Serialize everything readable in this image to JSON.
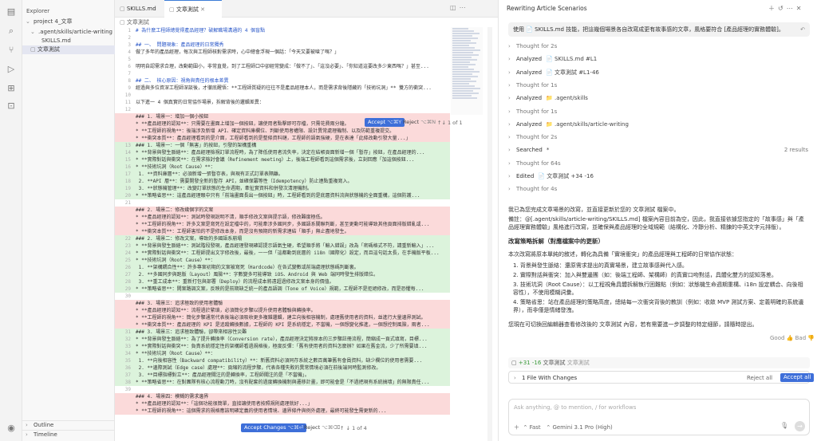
{
  "activity": {
    "icons": [
      "files-icon",
      "search-icon",
      "source-control-icon",
      "run-icon",
      "extensions-icon",
      "remote-icon",
      "account-icon"
    ]
  },
  "explorer": {
    "title": "Explorer",
    "project": "project 4_文章",
    "folder": ".agent/skills/article-writing",
    "file1": "SKILLS.md",
    "file2": "文章測試",
    "outline": "Outline",
    "timeline": "Timeline"
  },
  "tabs": {
    "tab1": "SKILLS.md",
    "tab2": "文章測試",
    "breadcrumb": "文章測試"
  },
  "code": {
    "lines": [
      {
        "n": "1",
        "t": "#  為什麼工程師總覺得產品經理？破解職場溝通的 4 個盲點",
        "k": "hd"
      },
      {
        "n": "2",
        "t": "",
        "k": ""
      },
      {
        "n": "3",
        "t": "## 一、 問題現象：產品經理的日常獨秀",
        "k": "hd"
      },
      {
        "n": "4",
        "t": "做了多年的產品經理，每次與工程師核對需求時，心中總會浮現一個話：「今天又要被嗆了嗎？」",
        "k": ""
      },
      {
        "n": "5",
        "t": "",
        "k": ""
      },
      {
        "n": "6",
        "t": "明明自認需求合理，改動範圍小，非常直覺，到了工程師口中卻經常變成：「做不了」、「這沒必要」、「你知道這要改多少東西嗎？」甚至...",
        "k": ""
      },
      {
        "n": "7",
        "t": "",
        "k": ""
      },
      {
        "n": "8",
        "t": "## 二、 核心原因：視角與責任的根本差異",
        "k": "hd"
      },
      {
        "n": "9",
        "t": "經過與多位資深工程師深談後，才徹底醒悟：**工程師質疑的往往不是產品經理本人，而是需求背後隱藏的「技術坑洞」** 雙方的衝突...",
        "k": ""
      },
      {
        "n": "10",
        "t": "",
        "k": ""
      },
      {
        "n": "11",
        "t": "以下進一 4 個真實的日常協作場景，拆解背後的邏輯差異：",
        "k": ""
      },
      {
        "n": "12",
        "t": "",
        "k": ""
      },
      {
        "n": "",
        "t": "### 1. 場景一：增加一個小按鈕",
        "k": "del"
      },
      {
        "n": "",
        "t": "* **產品經理的認知**：只需要在畫面上增加一個按鈕，讓使用者點擊即可存檔，只需花費兩分鐘。",
        "k": "del"
      },
      {
        "n": "",
        "t": "* **工程師的視角**：後端涉及新增 API、確定資料庫欄位、判斷使用者權限、設計異常處理機制、以及防範重複提交。",
        "k": "del"
      },
      {
        "n": "",
        "t": "* **衝突本質**：產品經理看到的是介面，工程師看到的是整條資料鏈，工程師的語氣強硬，是在表達「此條改動引發大量...」",
        "k": "del"
      },
      {
        "n": "13",
        "t": "### 1. 場景一：一個「無害」的按鈕，引發的架構重構",
        "k": "add"
      },
      {
        "n": "14",
        "t": "*   **背景與發生脈絡**：產品經理檢視訂單流程時，為了降低使用者流失率，決定在結帳頁面新增一個「暫存」按鈕，在產品經理的...",
        "k": "add"
      },
      {
        "n": "15",
        "t": "*   **實際對話與衝突**：在需求檢討會議（Refinement meeting）上，後端工程師看到這個需求後，立刻回應「加這個按鈕...",
        "k": "add"
      },
      {
        "n": "16",
        "t": "*   **技術坑洞（Root Cause）**：",
        "k": "add"
      },
      {
        "n": "17",
        "t": "    1.  **資料庫層**：必須新增一張暫存表，與現有正式訂單表隔離。",
        "k": "add"
      },
      {
        "n": "18",
        "t": "    2.  **API 層**：需要開發全新的暫存 API，並確保冪等性（Idempotency）防止連點重複寫入。",
        "k": "add"
      },
      {
        "n": "19",
        "t": "    3.  **狀態機管理**：改變訂單狀態的生命週期，牽扯實資料和併發次清理機制。",
        "k": "add"
      },
      {
        "n": "20",
        "t": "*   **策略省思**：這產品經理眼中只有「前端畫面長出一個按鈕」時，工程師看到的是底層資料流與狀態機的全面重構，這個防護...",
        "k": "add"
      },
      {
        "n": "21",
        "t": "",
        "k": ""
      },
      {
        "n": "",
        "t": "### 2. 場景二：修改幾個字的文案",
        "k": "del"
      },
      {
        "n": "",
        "t": "* **產品經理的認知**：測試時發現說明不清，順手修改文案與提示語，修改難度極低。",
        "k": "del"
      },
      {
        "n": "",
        "t": "* **工程師的視角**：許多文案是寫死在設定檔中的，可能牽涉多國同步，多國語系關聯判斷，甚至更動可能導致其他頁面排版錯亂或...",
        "k": "del"
      },
      {
        "n": "",
        "t": "* **衝突本質**：工程師害怕的不是修改本身，而是沒有預期的新需求連結「順手」無止盡地發生。",
        "k": "del"
      },
      {
        "n": "22",
        "t": "### 2. 場景二：修改文案，導致的多國語系崩塌",
        "k": "add"
      },
      {
        "n": "23",
        "t": "*   **背景與發生脈絡**：測試階段發現，產品經理發現確認提示語氣生硬，希望順手將「輸入錯誤」改為「密碼格式不符，請重新輸入」...",
        "k": "add"
      },
      {
        "n": "24",
        "t": "*   **實際對話與衝突**：工程師提出文字修改後，最後，一一但「這都動到底層的 i18n（國際化）設定，而且這句話太長，在手機版平板...",
        "k": "add"
      },
      {
        "n": "25",
        "t": "*   **技術坑洞（Root Cause）**：",
        "k": "add"
      },
      {
        "n": "26",
        "t": "    1.  **架構耦合性**：許多專案初期的文案被寫死（Hardcode）在各式變數或前端處理狀態碼判斷裏。",
        "k": "add"
      },
      {
        "n": "27",
        "t": "    2.  **多國同步與跑版（Layout）風險**：字數變多可能導致 iOS、Android 與 Web 端同時發生排版錯位。",
        "k": "add"
      },
      {
        "n": "28",
        "t": "    3.  **重工成本**：重新打包與部署（Deploy）的流程成本將遠超過修改文案本身的價值。",
        "k": "add"
      },
      {
        "n": "29",
        "t": "*   **策略省思**：開案路調文案，反映的是前期缺乏統一的產品語調（Tone of Voice）規範，工程師不是拒絕修改，而是恐懼每...",
        "k": "add"
      },
      {
        "n": "30",
        "t": "",
        "k": ""
      },
      {
        "n": "",
        "t": "### 3. 場景三：追求極致的使用者體驗",
        "k": "del"
      },
      {
        "n": "",
        "t": "* **產品經理的認知**：流程過於繁瑣，必須簡化步驟以提升使用者體驗與轉換率。",
        "k": "del"
      },
      {
        "n": "",
        "t": "* **工程師的視角**：簡化步驟通常代表後端必須吸收更多複雜邏輯，建立向後相容機制，處理舊使用者的資料，並進行大量邊界測試。",
        "k": "del"
      },
      {
        "n": "",
        "t": "* **衝突本質**：產品經理的 KPI 是追蹤轉換數據，工程師的 KPI 是系統穩定，不當機，一個想變化推進，一個想控制風險，兩者...",
        "k": "del"
      },
      {
        "n": "31",
        "t": "### 3. 場景三：追求極致體驗，卻帶來相容性災難",
        "k": "add"
      },
      {
        "n": "32",
        "t": "*   **背景與發生脈絡**：為了提升轉換率（Conversion rate），產品經理決定將原本的三步驟註冊流程，簡縮成一頁式填寫，目標...",
        "k": "add"
      },
      {
        "n": "33",
        "t": "*   **實際對話與衝突**：負責系統穩定性的架構師看過規格後，極度反彈：「舊有使用者的資料怎麼辦？如果在舊金流，少了所需要填...",
        "k": "add"
      },
      {
        "n": "34",
        "t": "*   **技術坑洞（Root Cause）**：",
        "k": "add"
      },
      {
        "n": "35",
        "t": "    1.  **向後相容性（Backward compatibility）**：新舊資料必須同存系統之數百萬筆舊有會員資料，缺少欄位的使用者需要...",
        "k": "add"
      },
      {
        "n": "36",
        "t": "    2.  **邊際測試（Edge case）處理**：頁縮的流程步驟，代表各種失敗的異常情境必須在前後端同時監測修改。",
        "k": "add"
      },
      {
        "n": "37",
        "t": "    3.  **目標指標對立**：產品經理關注的是轉換率，工程師關注的是「不當機」。",
        "k": "add"
      },
      {
        "n": "38",
        "t": "*   **策略省思**：在對團隊有核心流程動刀時，沒有配套的過度轉換機制與遷移計畫，即可能會是「不過把現有系統搞壞」的無限責任...",
        "k": "add"
      },
      {
        "n": "39",
        "t": "",
        "k": ""
      },
      {
        "n": "",
        "t": "### 4. 場景四：模糊的需求邊界",
        "k": "del"
      },
      {
        "n": "",
        "t": "* **產品經理的認知**：「這個功能很簡單，直接讓使用者按照規則處理就好...」",
        "k": "del"
      },
      {
        "n": "",
        "t": "* **工程師的視角**：這個需求的規格應該明確定義的使用者情境、邊界條件與例外處理，最終可能發生需更新的...",
        "k": "del"
      }
    ]
  },
  "diffbar": {
    "accept": "Accept",
    "accept_kbd": "⌥⌘Y",
    "reject": "Reject",
    "reject_kbd": "⌥⌘N",
    "accept2": "Accept Changes",
    "accept2_kbd": "⌥⌘⏎",
    "reject2": "Reject",
    "reject2_kbd": "⌥⌘⌫",
    "nav": "1 of 1",
    "nav2": "1 of 4"
  },
  "chat": {
    "title": "Rewriting Article Scenarios",
    "user_msg": "使用 📄 SKILLS.md 技能，把這幾個場景各自改寫成更有故事感的文章，風格要符合 [產品經理的實務體驗]。",
    "steps": [
      {
        "t": "Thought for 2s",
        "c": ""
      },
      {
        "t": "Analyzed",
        "c": "📄 SKILLS.md #L1"
      },
      {
        "t": "Analyzed",
        "c": "📄 文章測試 #L1-46"
      },
      {
        "t": "Thought for 1s",
        "c": ""
      },
      {
        "t": "Analyzed",
        "c": "📁 .agent/skills"
      },
      {
        "t": "Thought for 1s",
        "c": ""
      },
      {
        "t": "Analyzed",
        "c": "📁 .agent/skills/article-writing"
      },
      {
        "t": "Thought for 2s",
        "c": ""
      },
      {
        "t": "Searched",
        "c": "*",
        "r": "2 results"
      },
      {
        "t": "Thought for 64s",
        "c": ""
      },
      {
        "t": "Edited",
        "c": "📄 文章測試 +34 -16"
      },
      {
        "t": "Thought for 4s",
        "c": ""
      }
    ],
    "p1": "我已為您完成文章場景的改寫，並直接更新於您的 文章測試 檔案中。",
    "p2": "備註：@[.agent/skills/article-writing/SKILLS.md] 檔案內容目前為空，因此，我直接依據您指定的「故事感」與「產品經理實務體驗」風格進行改寫，並確保與產品經理的全域規範（結構化、冷靜分析、精鍊的中英文字元排版）。",
    "h1": "改寫策略拆解（對應檔案中的更新）",
    "p3": "本次改寫將原本單純的敘述，轉化為具備「實境衝突」的產品經理與工程師的日常協作狀態：",
    "list": [
      "1. 背景與發生脈絡：還原需求提出的真實場景，建立故事感與代入感。",
      "2. 實際對話與衝突：加入與雙邊團（如：後端工程師、架構師）的真實口吻對話，具體化雙方的認知落差。",
      "3. 技術坑洞（Root Cause）：以工程視角具體拆解執行困難點（例如：狀態機生命週期重構、i18n 設定耦合、向後相容性），不使用模糊詞彙。",
      "4. 策略省思：站在產品經理的策略高度，總結每一次衝突背後的教訓（例如：收斂 MVP 測試方案、定義明確的系統邊界），而非僅是情緒發洩。"
    ],
    "p4": "您現在可切換回編輯器查看修改後的 文章測試 內容，若有需要進一步調整的特定細節，請隨時提出。",
    "good": "Good",
    "bad": "Bad",
    "changes_count": "+31 -16",
    "changes_file": "文章測試",
    "changes_file2": "文章測試",
    "files_changed": "1 File With Changes",
    "reject_all": "Reject all",
    "accept_all": "Accept all",
    "input_placeholder": "Ask anything, @ to mention, / for workflows",
    "mode": "Fast",
    "model": "Gemini 3.1 Pro (High)"
  }
}
